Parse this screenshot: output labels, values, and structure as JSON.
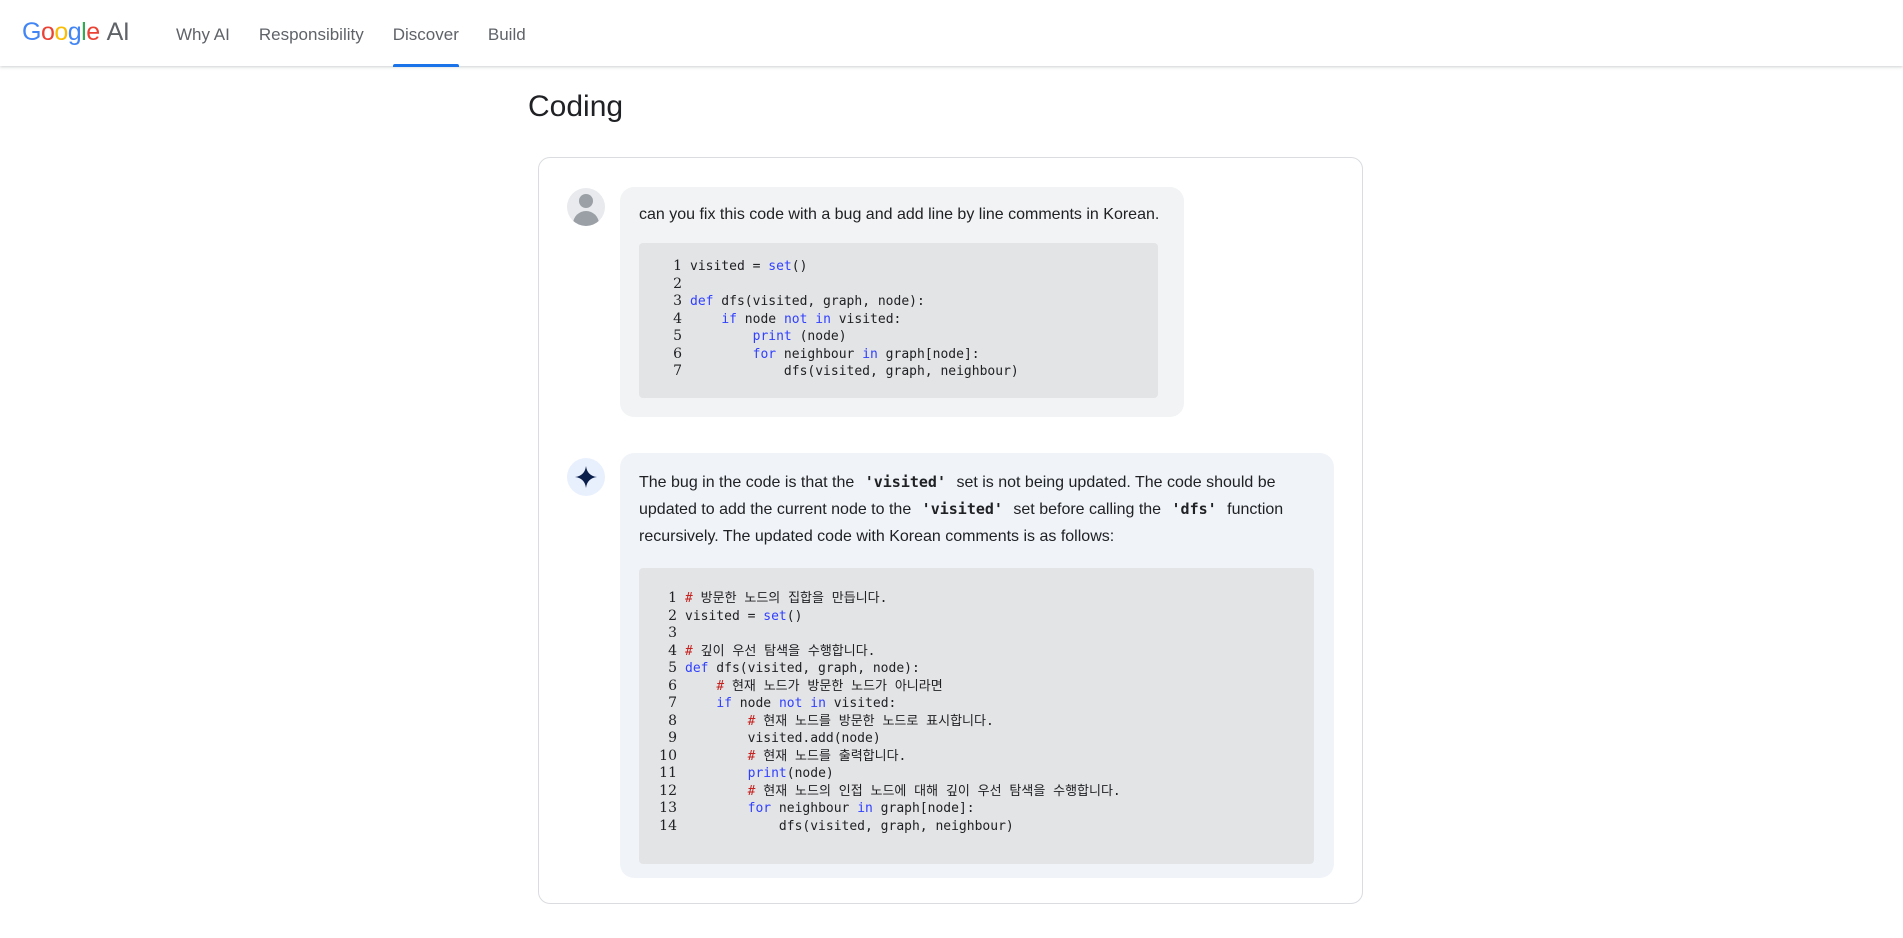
{
  "brand": {
    "logo_text": "Google",
    "logo_suffix": "AI"
  },
  "nav": {
    "items": [
      {
        "label": "Why AI",
        "active": false
      },
      {
        "label": "Responsibility",
        "active": false
      },
      {
        "label": "Discover",
        "active": true
      },
      {
        "label": "Build",
        "active": false
      }
    ]
  },
  "page": {
    "title": "Coding"
  },
  "conversation": {
    "user": {
      "avatar": "user-avatar-icon",
      "message": "can you fix this code with a bug and add line by line comments in Korean.",
      "code": [
        {
          "n": "1",
          "text": "visited = set()"
        },
        {
          "n": "2",
          "text": ""
        },
        {
          "n": "3",
          "text": "def dfs(visited, graph, node):"
        },
        {
          "n": "4",
          "text": "    if node not in visited:"
        },
        {
          "n": "5",
          "text": "        print (node)"
        },
        {
          "n": "6",
          "text": "        for neighbour in graph[node]:"
        },
        {
          "n": "7",
          "text": "            dfs(visited, graph, neighbour)"
        }
      ]
    },
    "model": {
      "avatar": "gemini-sparkle-icon",
      "message": {
        "p1": "The bug in the code is that the",
        "code1": "'visited'",
        "p2": "set is not being updated. The code should be updated to add the current node to the",
        "code2": "'visited'",
        "p3": "set before calling the",
        "code3": "'dfs'",
        "p4": "function recursively. The updated code with Korean comments is as follows:"
      },
      "code": [
        {
          "n": "1",
          "text": "# 방문한 노드의 집합을 만듭니다."
        },
        {
          "n": "2",
          "text": "visited = set()"
        },
        {
          "n": "3",
          "text": ""
        },
        {
          "n": "4",
          "text": "# 깊이 우선 탐색을 수행합니다."
        },
        {
          "n": "5",
          "text": "def dfs(visited, graph, node):"
        },
        {
          "n": "6",
          "text": "    # 현재 노드가 방문한 노드가 아니라면"
        },
        {
          "n": "7",
          "text": "    if node not in visited:"
        },
        {
          "n": "8",
          "text": "        # 현재 노드를 방문한 노드로 표시합니다."
        },
        {
          "n": "9",
          "text": "        visited.add(node)"
        },
        {
          "n": "10",
          "text": "        # 현재 노드를 출력합니다."
        },
        {
          "n": "11",
          "text": "        print(node)"
        },
        {
          "n": "12",
          "text": "        # 현재 노드의 인접 노드에 대해 깊이 우선 탐색을 수행합니다."
        },
        {
          "n": "13",
          "text": "        for neighbour in graph[node]:"
        },
        {
          "n": "14",
          "text": "            dfs(visited, graph, neighbour)"
        }
      ]
    }
  },
  "colors": {
    "accent": "#1a73e8",
    "keyword": "#3040ff",
    "comment_hash": "#c5221f"
  }
}
